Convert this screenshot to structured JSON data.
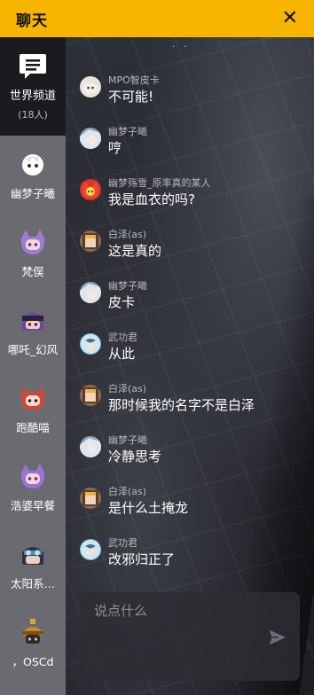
{
  "header": {
    "title": "聊天",
    "close_glyph": "✕"
  },
  "world_channel": {
    "name": "世界频道",
    "count": "(18人)",
    "icon": "chat-bubble-icon"
  },
  "members": [
    {
      "name": "幽梦子曦",
      "color": "#e8e2e4"
    },
    {
      "name": "梵俣",
      "color": "#a07bd6"
    },
    {
      "name": "哪吒_幻风",
      "color": "#6b4aa0"
    },
    {
      "name": "跑酷喵",
      "color": "#d0463b"
    },
    {
      "name": "浩婆早餐",
      "color": "#9a72d8"
    },
    {
      "name": "太阳系…",
      "color": "#4a8fb0"
    },
    {
      "name": "，OSCd",
      "color": "#c58a2c"
    }
  ],
  "messages": [
    {
      "sender": "MPO智皮卡",
      "text": "不可能!",
      "avatar": "#e9e4dc"
    },
    {
      "sender": "幽梦子曦",
      "text": "哼",
      "avatar": "#8fa6bf"
    },
    {
      "sender": "幽梦殇雪_原率真的某人",
      "text": "我是血衣的吗?",
      "avatar": "#d6362c"
    },
    {
      "sender": "白泽(as)",
      "text": "这是真的",
      "avatar": "#8f6a4e"
    },
    {
      "sender": "幽梦子曦",
      "text": "皮卡",
      "avatar": "#8fa6bf"
    },
    {
      "sender": "武功君",
      "text": "从此",
      "avatar": "#7fb7d8"
    },
    {
      "sender": "白泽(as)",
      "text": "那时候我的名字不是白泽",
      "avatar": "#8f6a4e"
    },
    {
      "sender": "幽梦子曦",
      "text": "冷静思考",
      "avatar": "#8fa6bf"
    },
    {
      "sender": "白泽(as)",
      "text": "是什么土掩龙",
      "avatar": "#8f6a4e"
    },
    {
      "sender": "武功君",
      "text": "改邪归正了",
      "avatar": "#7fb7d8"
    }
  ],
  "composer": {
    "placeholder": "说点什么",
    "send_icon": "send-arrow-icon"
  },
  "colors": {
    "header_bg": "#f7b500",
    "sidebar_bg": "#1a1b1f",
    "member_list_bg": "#6a6b70"
  }
}
